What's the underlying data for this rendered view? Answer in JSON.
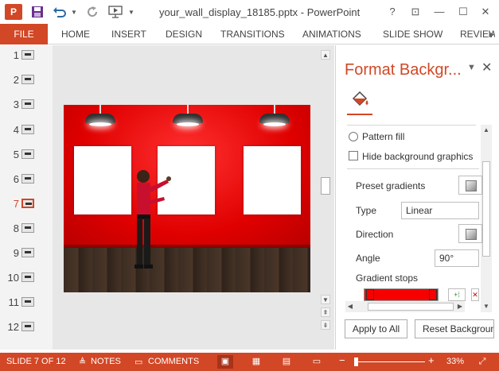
{
  "window": {
    "title": "your_wall_display_18185.pptx - PowerPoint",
    "help": "?",
    "restore_ribbon": "⊡",
    "minimize": "—",
    "maximize": "☐",
    "close": "✕",
    "logo": "P"
  },
  "ribbon": {
    "tabs": [
      "FILE",
      "HOME",
      "INSERT",
      "DESIGN",
      "TRANSITIONS",
      "ANIMATIONS",
      "SLIDE SHOW",
      "REVIEW"
    ]
  },
  "thumbnails": {
    "numbers": [
      "1",
      "2",
      "3",
      "4",
      "5",
      "6",
      "7",
      "8",
      "9",
      "10",
      "11",
      "12"
    ],
    "active_index": 6,
    "accent": "#d24726"
  },
  "slide": {
    "wall_color": "#ee1c1c",
    "floor_color": "#3b2c22"
  },
  "format_pane": {
    "title": "Format Backgr...",
    "pattern_fill": "Pattern fill",
    "hide_background": "Hide background graphics",
    "preset_gradients": "Preset gradients",
    "type_label": "Type",
    "type_value": "Linear",
    "direction_label": "Direction",
    "angle_label": "Angle",
    "angle_value": "90°",
    "gradient_stops": "Gradient stops",
    "apply_to_all": "Apply to All",
    "reset_background": "Reset Background"
  },
  "status": {
    "slide_info": "SLIDE 7 OF 12",
    "notes": "NOTES",
    "comments": "COMMENTS",
    "zoom": "33%",
    "zoom_minus": "−",
    "zoom_plus": "+"
  },
  "colors": {
    "accent": "#d24726",
    "gradient_stop": "#f70000"
  }
}
